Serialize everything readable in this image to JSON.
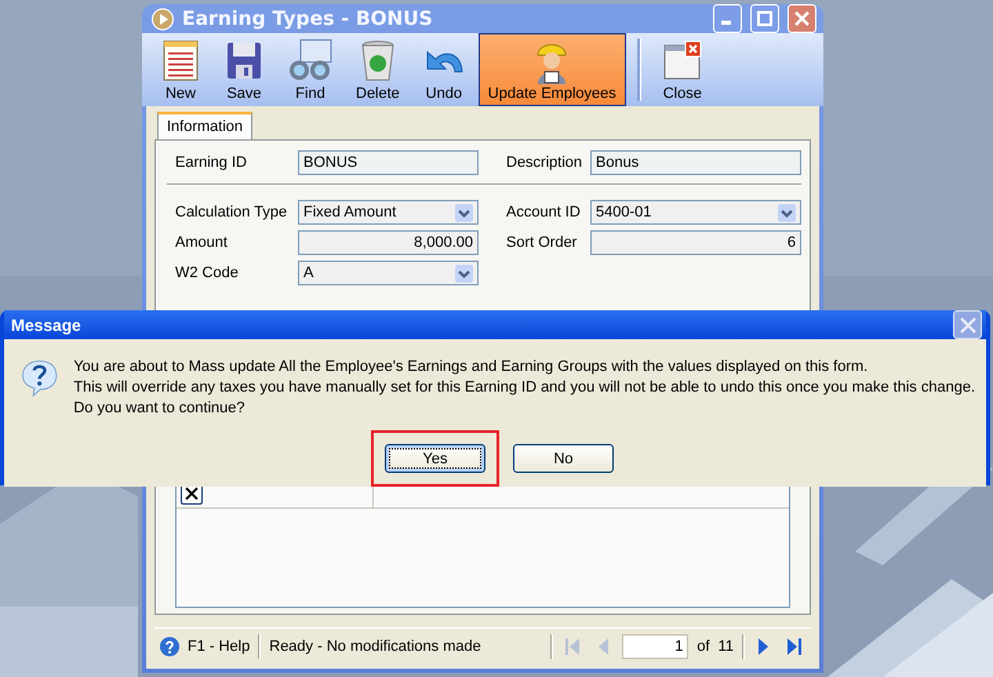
{
  "window": {
    "title": "Earning Types - BONUS"
  },
  "toolbar": [
    {
      "label": "New",
      "kind": "new",
      "selected": false
    },
    {
      "label": "Save",
      "kind": "save",
      "selected": false
    },
    {
      "label": "Find",
      "kind": "find",
      "selected": false
    },
    {
      "label": "Delete",
      "kind": "delete",
      "selected": false
    },
    {
      "label": "Undo",
      "kind": "undo",
      "selected": false
    },
    {
      "label": "Update Employees",
      "kind": "employees",
      "selected": true
    },
    {
      "label": "Close",
      "kind": "close",
      "selected": false
    }
  ],
  "tabs": [
    {
      "label": "Information",
      "selected": true
    }
  ],
  "form": {
    "header": [
      {
        "label": "Earning ID",
        "value": "BONUS",
        "kind": "text"
      },
      {
        "label": "Description",
        "value": "Bonus",
        "kind": "text"
      }
    ],
    "rows": [
      [
        {
          "label": "Calculation Type",
          "value": "Fixed Amount",
          "kind": "combo"
        },
        {
          "label": "Account ID",
          "value": "5400-01",
          "kind": "combo"
        }
      ],
      [
        {
          "label": "Amount",
          "value": "8,000.00",
          "kind": "number"
        },
        {
          "label": "Sort Order",
          "value": "6",
          "kind": "number"
        }
      ],
      [
        {
          "label": "W2 Code",
          "value": "A",
          "kind": "combo"
        }
      ]
    ]
  },
  "status_bar": {
    "help": "F1 - Help",
    "message": "Ready - No modifications made",
    "page": "1",
    "of": "of",
    "total": "11",
    "nav": [
      {
        "kind": "first",
        "disabled": true
      },
      {
        "kind": "prev",
        "disabled": true
      },
      {
        "kind": "next",
        "disabled": false
      },
      {
        "kind": "last",
        "disabled": false
      }
    ]
  },
  "dialog": {
    "title": "Message",
    "lines": [
      "You are about to Mass update All the Employee's Earnings and Earning Groups with the values displayed on this form.",
      "This will override any taxes you have manually set for this Earning ID and you will not be able to undo this once you make this change.",
      "Do you want to continue?"
    ],
    "buttons": [
      {
        "label": "Yes",
        "focused": true,
        "highlighted": true
      },
      {
        "label": "No",
        "focused": false,
        "highlighted": false
      }
    ]
  }
}
